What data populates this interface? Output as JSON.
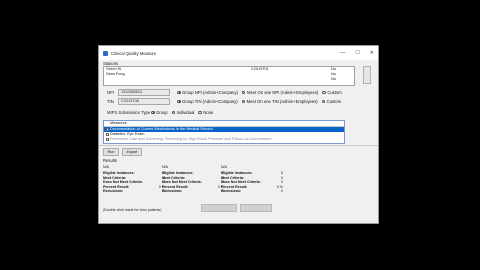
{
  "window": {
    "title": "Clinical Quality Measure",
    "minimize": "—",
    "maximize": "☐",
    "close": "✕"
  },
  "stations": {
    "label": "Stations",
    "rows": [
      {
        "name": "Green Hi",
        "code": "C2019T01",
        "flag": "No"
      },
      {
        "name": "Sean Fong",
        "code": "",
        "flag": "No"
      },
      {
        "name": "",
        "code": "",
        "flag": "No"
      }
    ]
  },
  "npi": {
    "label": "NPI",
    "value": "1932688624",
    "options": [
      "Group NPI (Admin+Company)",
      "Meet On one NPI (Admin+Employees)",
      "Custom"
    ],
    "selected": 0
  },
  "tin": {
    "label": "TIN",
    "value": "C2019T08",
    "options": [
      "Group TIN (Admin+Company)",
      "Meet On one TIN (Admin+Employees)",
      "Custom"
    ],
    "selected": 0
  },
  "submission": {
    "label": "MIPS Submission Type",
    "options": [
      "Group",
      "Individual",
      "None"
    ],
    "selected": 0
  },
  "measures": {
    "header": "Measures",
    "rows": [
      {
        "text": "Documentation of Current Medications in the Medical Record",
        "selected": true
      },
      {
        "text": "Diabetes: Eye Exam",
        "selected": false
      },
      {
        "text": "Preventive Care and Screening: Screening for High Blood Pressure and Follow-Up Documented",
        "selected": false
      }
    ]
  },
  "buttons": {
    "run": "Run",
    "export": "Export"
  },
  "results": {
    "label": "Results",
    "columns": [
      {
        "header": "N/A",
        "lines": [
          [
            "Eligible Instances:",
            "0"
          ],
          [
            "Meet Criteria:",
            "0"
          ],
          [
            "Does Not Meet Criteria:",
            "0"
          ],
          [
            "Percent Result:",
            "0 %"
          ],
          [
            "Exclusions:",
            "0"
          ]
        ]
      },
      {
        "header": "N/A",
        "lines": [
          [
            "Eligible Instances:",
            "0"
          ],
          [
            "Meet Criteria:",
            "0"
          ],
          [
            "Does Not Meet Criteria:",
            "0"
          ],
          [
            "Percent Result:",
            "0 %"
          ],
          [
            "Exclusions:",
            "0"
          ]
        ]
      },
      {
        "header": "N/A",
        "lines": [
          [
            "Eligible Instances:",
            "0"
          ],
          [
            "Meet Criteria:",
            "0"
          ],
          [
            "Does Not Meet Criteria:",
            "0"
          ],
          [
            "Percent Result:",
            "0 %"
          ],
          [
            "Exclusions:",
            "0"
          ]
        ]
      }
    ]
  },
  "footer_note": "(Double click result for view patients)"
}
